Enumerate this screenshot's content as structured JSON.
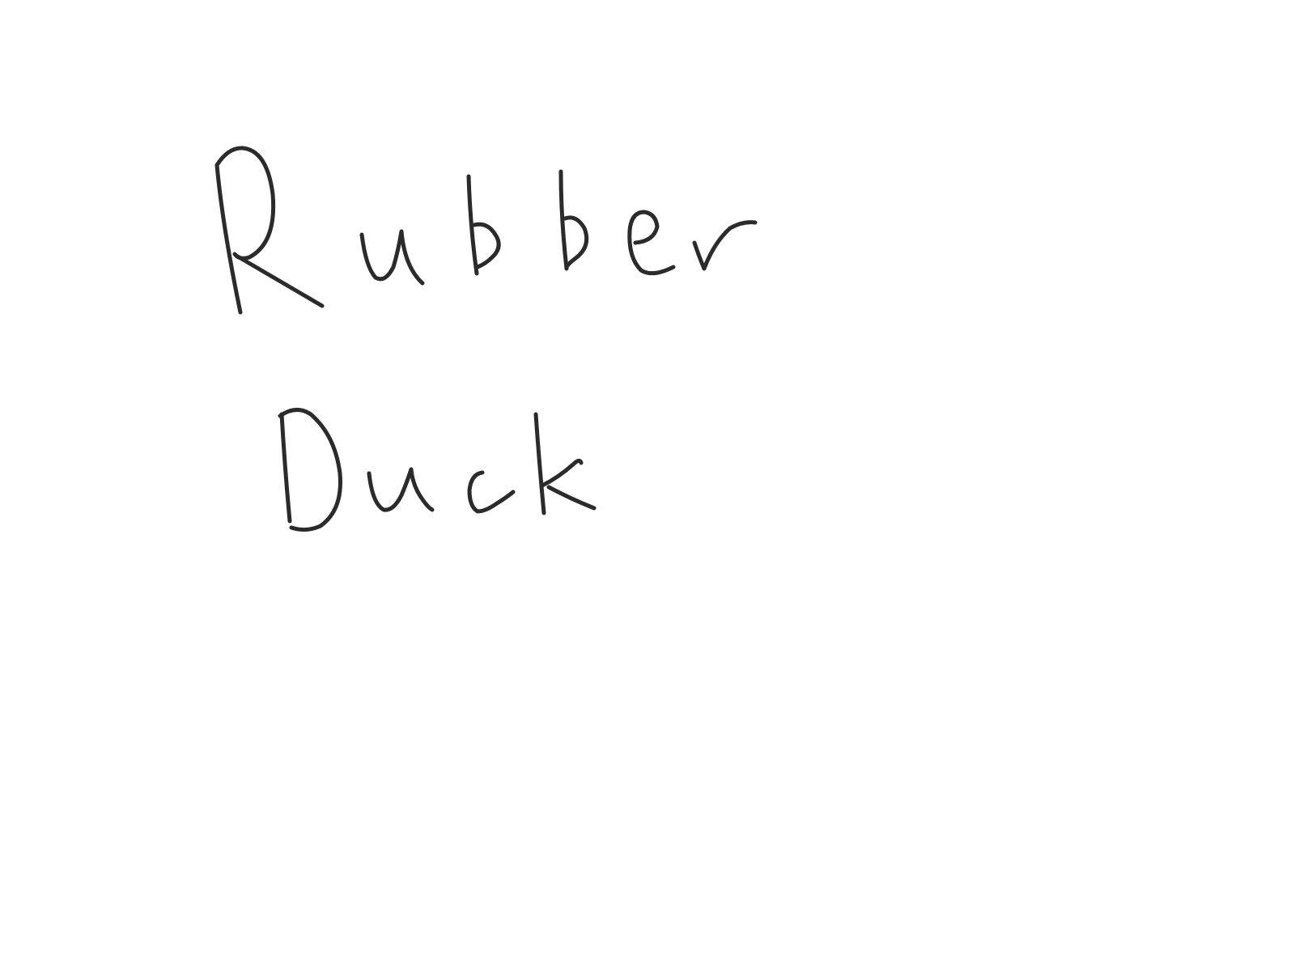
{
  "canvas": {
    "background": "#ffffff",
    "ink_color": "#2b2b2b"
  },
  "handwriting": {
    "line1": "Rubber",
    "line2": "Duck"
  }
}
